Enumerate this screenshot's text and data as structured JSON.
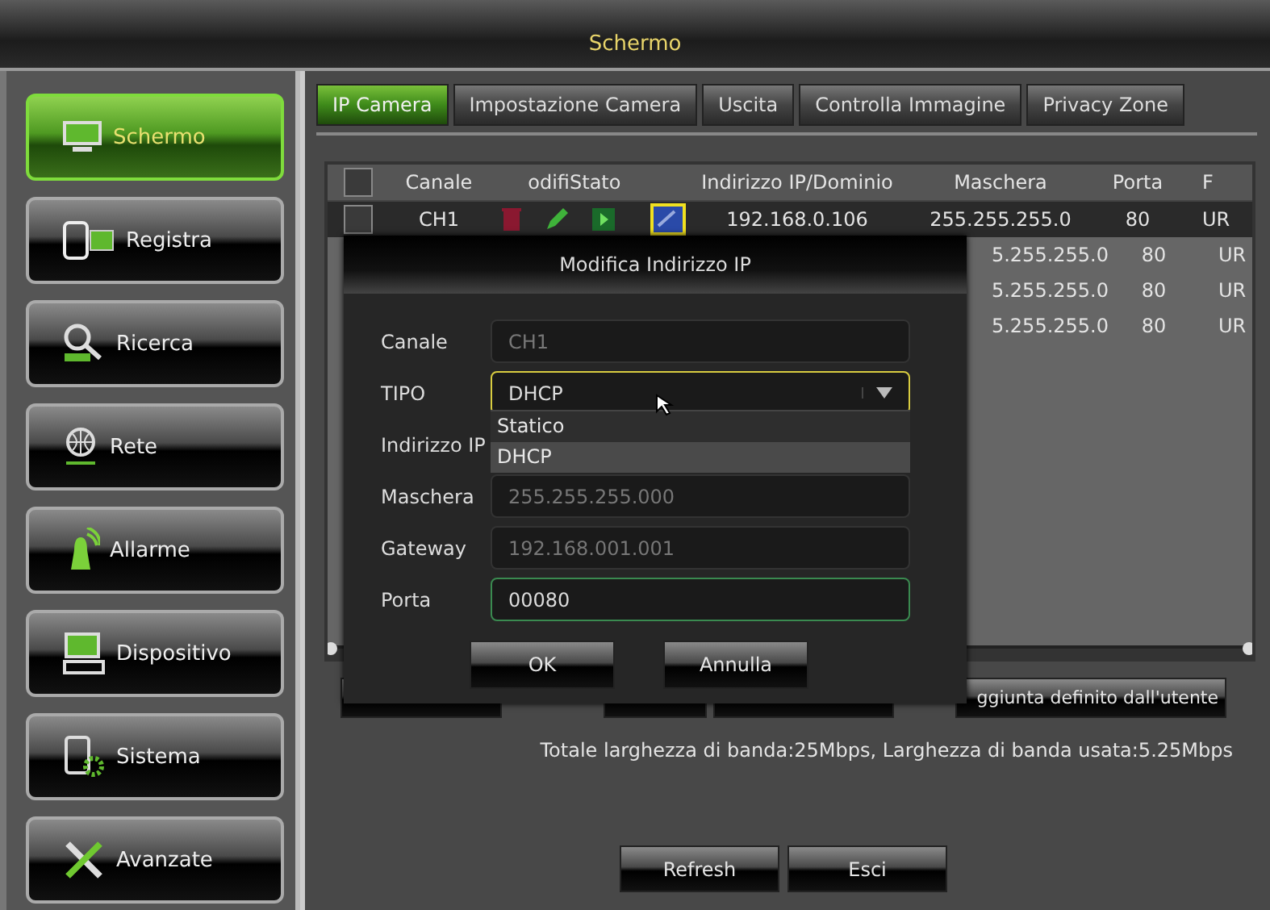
{
  "window": {
    "title": "Schermo"
  },
  "sidebar": {
    "items": [
      {
        "label": "Schermo",
        "selected": true
      },
      {
        "label": "Registra",
        "selected": false
      },
      {
        "label": "Ricerca",
        "selected": false
      },
      {
        "label": "Rete",
        "selected": false
      },
      {
        "label": "Allarme",
        "selected": false
      },
      {
        "label": "Dispositivo",
        "selected": false
      },
      {
        "label": "Sistema",
        "selected": false
      },
      {
        "label": "Avanzate",
        "selected": false
      }
    ]
  },
  "tabs": [
    {
      "label": "IP Camera",
      "selected": true
    },
    {
      "label": "Impostazione Camera",
      "selected": false
    },
    {
      "label": "Uscita",
      "selected": false
    },
    {
      "label": "Controlla Immagine",
      "selected": false
    },
    {
      "label": "Privacy Zone",
      "selected": false
    }
  ],
  "table": {
    "header_checkbox": {
      "checked": false
    },
    "columns": [
      "Canale",
      "odifi",
      "Stato",
      "Indirizzo IP/Dominio",
      "Maschera",
      "Porta",
      "F"
    ],
    "rows": [
      {
        "kind": "full",
        "checked": false,
        "channel": "CH1",
        "actions": [
          {
            "kind": "delete",
            "selected": false
          },
          {
            "kind": "edit",
            "selected": false
          },
          {
            "kind": "play",
            "selected": false
          },
          {
            "kind": "config",
            "selected": true
          }
        ],
        "address": "192.168.0.106",
        "mask": "255.255.255.0",
        "port": "80",
        "column_9": "UR"
      },
      {
        "kind": "covered",
        "mask": "5.255.255.0",
        "port": "80",
        "column_9": "UR"
      },
      {
        "kind": "covered",
        "mask": "5.255.255.0",
        "port": "80",
        "column_9": "UR"
      },
      {
        "kind": "covered",
        "mask": "5.255.255.0",
        "port": "80",
        "column_9": "UR"
      }
    ]
  },
  "action_buttons": [
    {
      "kind": "covered"
    },
    {
      "kind": "covered"
    },
    {
      "kind": "covered"
    },
    {
      "kind": "labeled",
      "label": "ggiunta definito dall'utente"
    }
  ],
  "bandwidth": "Totale larghezza di banda:25Mbps, Larghezza di banda usata:5.25Mbps",
  "footer_buttons": [
    "Refresh",
    "Esci"
  ],
  "dialog": {
    "title": "Modifica Indirizzo IP",
    "fields": [
      {
        "kind": "text",
        "label": "Canale",
        "value": "CH1",
        "disabled": true,
        "focused": false,
        "active": false
      },
      {
        "kind": "select",
        "label": "TIPO",
        "value": "DHCP",
        "disabled": false,
        "focused": true,
        "active": false
      },
      {
        "kind": "covered",
        "label": "Indirizzo IP"
      },
      {
        "kind": "text",
        "label": "Maschera",
        "value": "255.255.255.000",
        "disabled": true,
        "focused": false,
        "active": false
      },
      {
        "kind": "text",
        "label": "Gateway",
        "value": "192.168.001.001",
        "disabled": true,
        "focused": false,
        "active": false
      },
      {
        "kind": "text",
        "label": "Porta",
        "value": "00080",
        "disabled": false,
        "focused": false,
        "active": true
      }
    ],
    "dropdown": [
      {
        "label": "Statico",
        "selected": false
      },
      {
        "label": "DHCP",
        "selected": true
      }
    ],
    "buttons": [
      "OK",
      "Annulla"
    ]
  }
}
